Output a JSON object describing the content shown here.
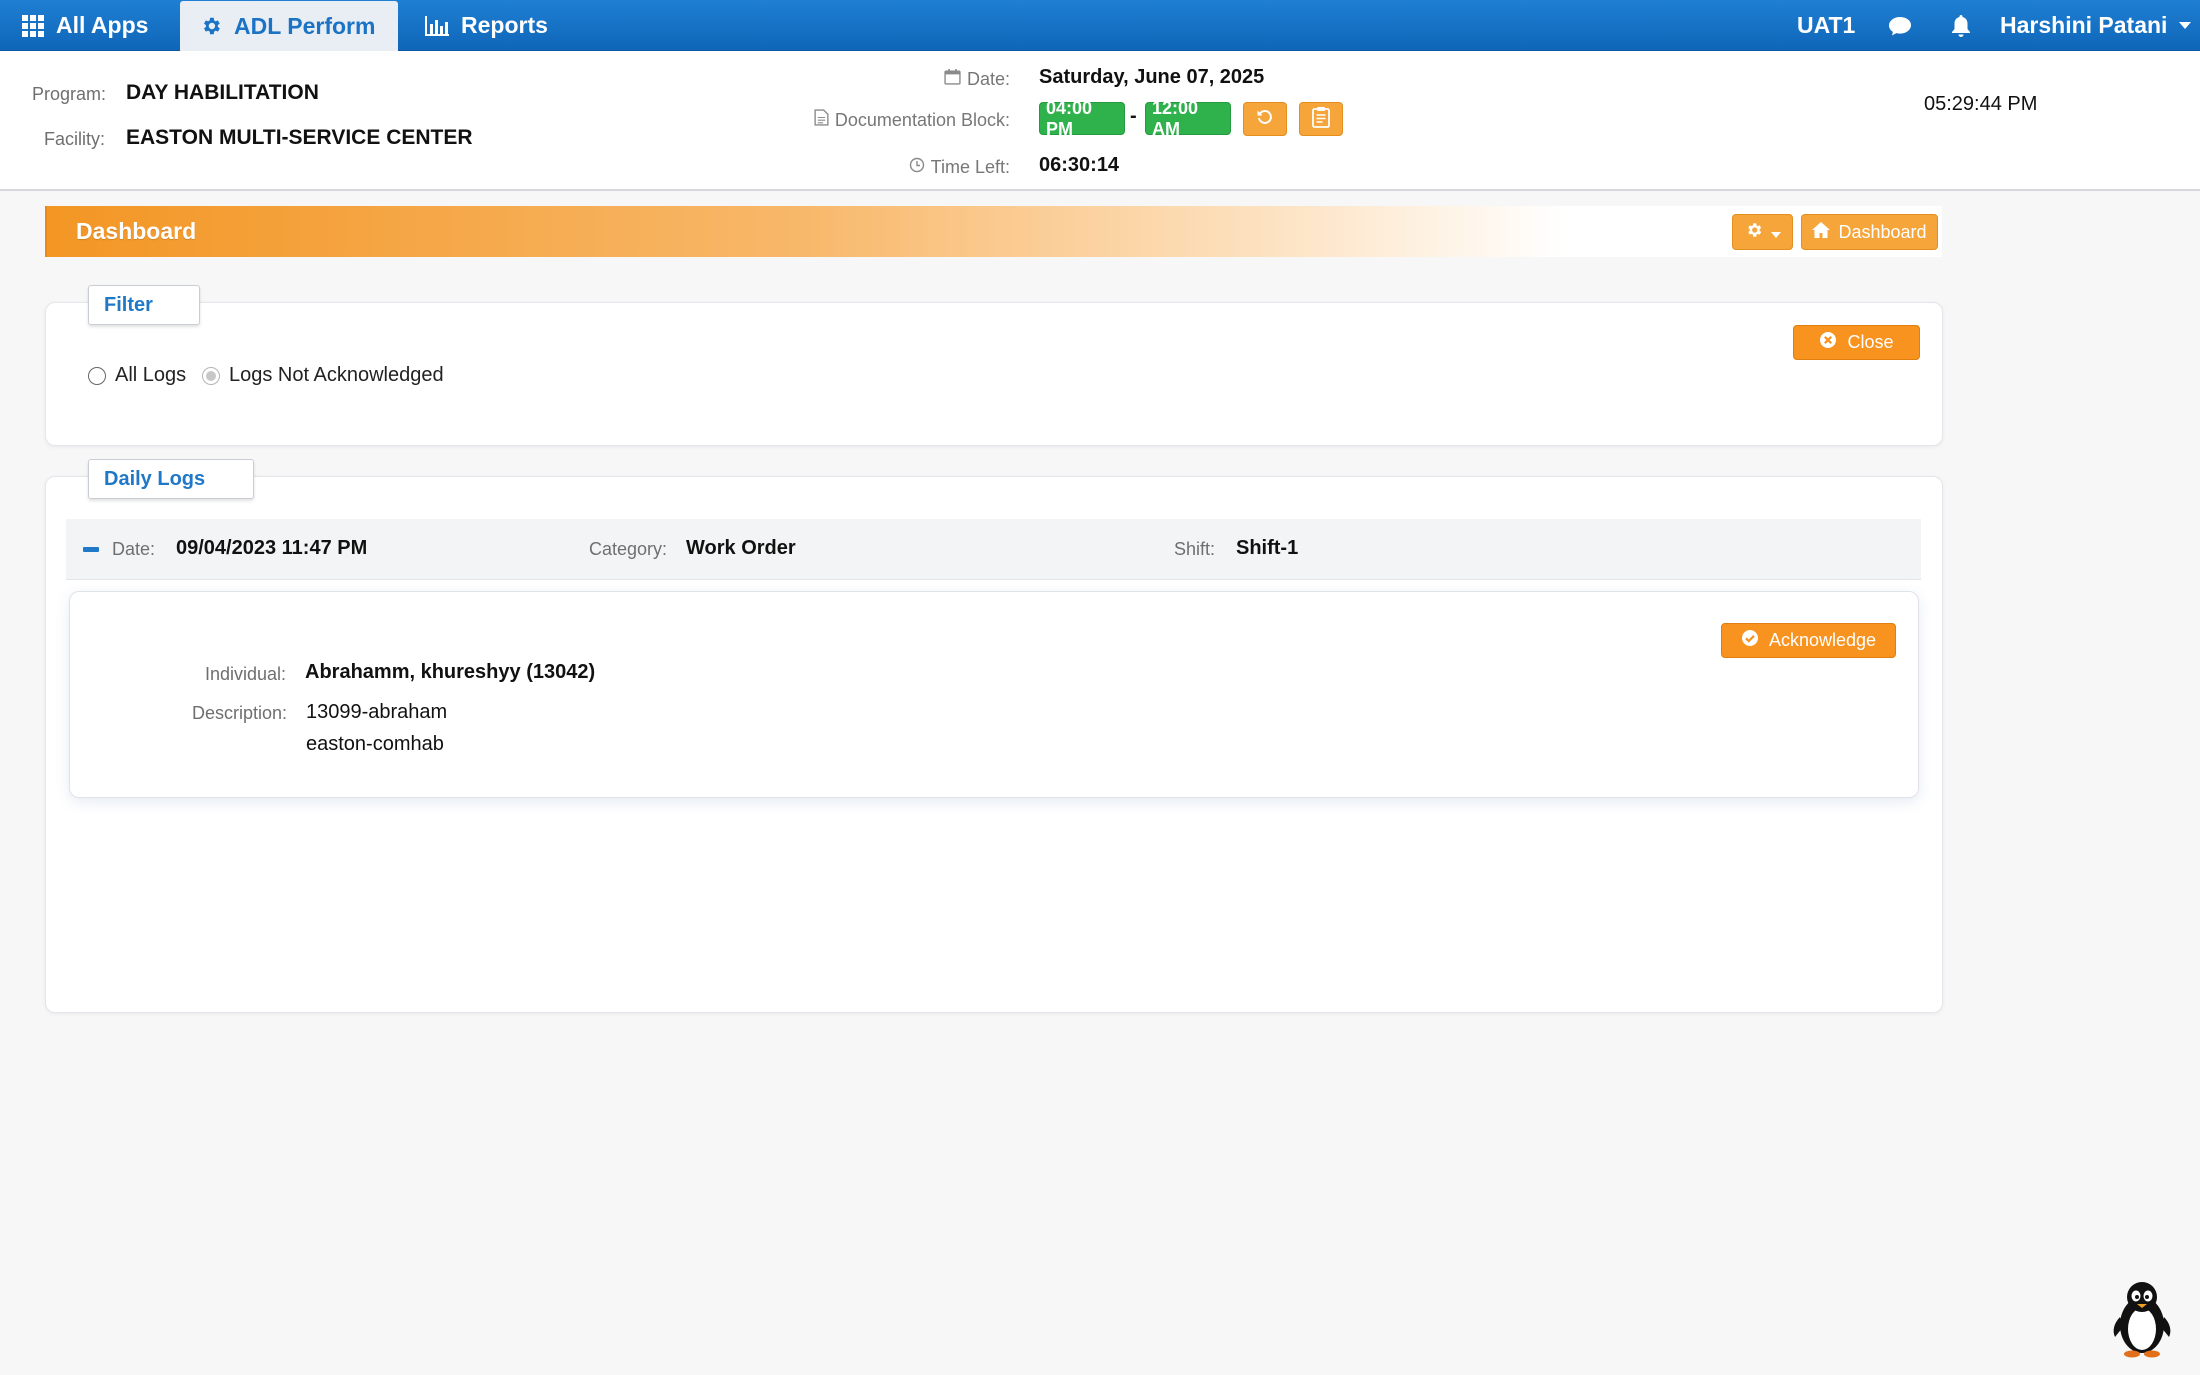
{
  "nav": {
    "all_apps": "All Apps",
    "adl_perform": "ADL Perform",
    "reports": "Reports",
    "environment": "UAT1",
    "user_name": "Harshini Patani"
  },
  "header": {
    "program_label": "Program:",
    "program_value": "DAY HABILITATION",
    "facility_label": "Facility:",
    "facility_value": "EASTON MULTI-SERVICE CENTER",
    "date_label": "Date:",
    "date_value": "Saturday, June 07, 2025",
    "doc_block_label": "Documentation Block:",
    "block_start": "04:00 PM",
    "block_separator": "-",
    "block_end": "12:00 AM",
    "time_left_label": "Time Left:",
    "time_left_value": "06:30:14",
    "clock": "05:29:44 PM"
  },
  "dashboard": {
    "title": "Dashboard",
    "dashboard_button": "Dashboard"
  },
  "filter": {
    "legend": "Filter",
    "options": [
      "All Logs",
      "Logs Not Acknowledged"
    ],
    "selected": "Logs Not Acknowledged",
    "close_button": "Close"
  },
  "daily_logs": {
    "legend": "Daily Logs",
    "entry": {
      "date_label": "Date:",
      "date_value": "09/04/2023 11:47 PM",
      "category_label": "Category:",
      "category_value": "Work Order",
      "shift_label": "Shift:",
      "shift_value": "Shift-1",
      "individual_label": "Individual:",
      "individual_value": "Abrahamm, khureshyy (13042)",
      "description_label": "Description:",
      "description_lines": [
        "13099-abraham",
        "easton-comhab"
      ],
      "acknowledge_button": "Acknowledge"
    }
  },
  "colors": {
    "nav_blue": "#1470c4",
    "accent_orange": "#f7931e",
    "block_green": "#2fb14c",
    "legend_blue": "#1f78c8"
  }
}
